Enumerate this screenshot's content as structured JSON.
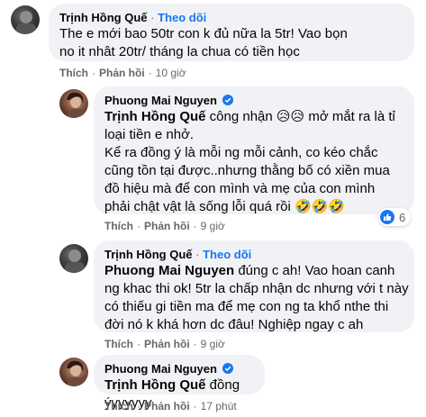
{
  "comments": [
    {
      "author": "Trịnh Hồng Quế",
      "follow": "Theo dõi",
      "separator": "·",
      "text": "The e mới bao 50tr con k đủ nữa la 5tr! Vao bọn no it nhât 20tr/ tháng la chua có tiền học",
      "like": "Thích",
      "reply": "Phản hồi",
      "time": "10 giờ"
    },
    {
      "author": "Phuong Mai Nguyen",
      "mention": "Trịnh Hồng Quế",
      "text_line1": " công nhận 😥😥 mở mắt ra là tỉ loại tiền e nhở.",
      "text_p2": "Kể ra đồng ý là mỗi ng mỗi cảnh, co kéo chắc cũng tồn tại được..nhưng thằng bố có xiền mua đồ hiệu mà để con mình và mẹ của con mình phải chật vật là sống lỗi quá rồi 🤣🤣🤣",
      "like": "Thích",
      "reply": "Phản hồi",
      "time": "9 giờ",
      "reaction_count": "6"
    },
    {
      "author": "Trịnh Hồng Quế",
      "follow": "Theo dõi",
      "separator": "·",
      "mention": "Phuong Mai Nguyen",
      "text": " đúng c ah! Vao hoan canh ng khac thi ok! 5tr la chấp nhận dc nhưng với t này có thiếu gi tiền ma để mẹ con ng ta khổ nthe thi đời nó k khá hơn dc đâu! Nghiệp ngay c ah",
      "like": "Thích",
      "reply": "Phản hồi",
      "time": "9 giờ"
    },
    {
      "author": "Phuong Mai Nguyen",
      "mention": "Trịnh Hồng Quế",
      "text": " đồng ýyyyyyy",
      "like": "Thích",
      "reply": "Phản hồi",
      "time": "17 phút"
    }
  ],
  "colors": {
    "bubble": "#f0f2f5",
    "follow": "#1877f2",
    "meta": "#65676b"
  },
  "icons": {
    "verified": "verified-badge-icon",
    "like": "like-thumb-icon"
  }
}
